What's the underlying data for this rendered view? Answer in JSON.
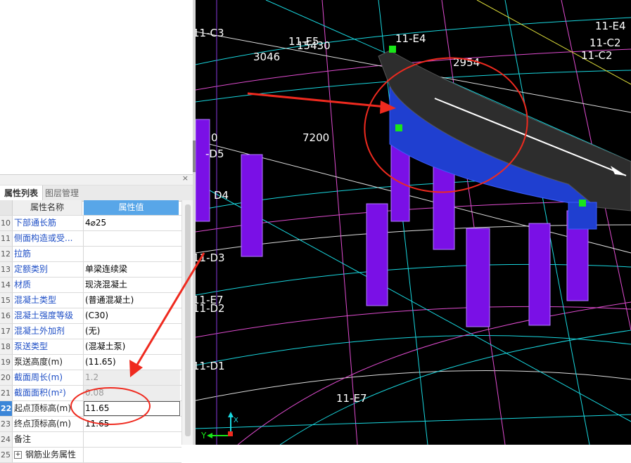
{
  "panel": {
    "close_label": "×",
    "tabs": [
      {
        "label": "属性列表",
        "active": true
      },
      {
        "label": "图层管理",
        "active": false
      }
    ],
    "header": {
      "name": "属性名称",
      "value": "属性值"
    },
    "rows": [
      {
        "num": "10",
        "name": "下部通长筋",
        "value": "4⌀25",
        "link": true
      },
      {
        "num": "11",
        "name": "侧面构造或受...",
        "value": "",
        "link": true
      },
      {
        "num": "12",
        "name": "拉筋",
        "value": "",
        "link": true
      },
      {
        "num": "13",
        "name": "定额类别",
        "value": "单梁连续梁",
        "link": true
      },
      {
        "num": "14",
        "name": "材质",
        "value": "现浇混凝土",
        "link": true
      },
      {
        "num": "15",
        "name": "混凝土类型",
        "value": "(普通混凝土)",
        "link": true
      },
      {
        "num": "16",
        "name": "混凝土强度等级",
        "value": "(C30)",
        "link": true
      },
      {
        "num": "17",
        "name": "混凝土外加剂",
        "value": "(无)",
        "link": true
      },
      {
        "num": "18",
        "name": "泵送类型",
        "value": "(混凝土泵)",
        "link": true
      },
      {
        "num": "19",
        "name": "泵送高度(m)",
        "value": "(11.65)",
        "link": false
      },
      {
        "num": "20",
        "name": "截面周长(m)",
        "value": "1.2",
        "link": true,
        "gray": true
      },
      {
        "num": "21",
        "name": "截面面积(m²)",
        "value": "0.08",
        "link": true,
        "gray": true
      },
      {
        "num": "22",
        "name": "起点顶标高(m)",
        "value": "11.65",
        "link": false,
        "selected": true,
        "boxed": true
      },
      {
        "num": "23",
        "name": "终点顶标高(m)",
        "value": "11.65",
        "link": false
      },
      {
        "num": "24",
        "name": "备注",
        "value": "",
        "link": false
      },
      {
        "num": "25",
        "name": "钢筋业务属性",
        "value": "",
        "link": false,
        "expand": "+"
      }
    ]
  },
  "viewport": {
    "grid_labels": [
      "11-C3",
      "11-E5",
      "15430",
      "11-E4",
      "11-E4",
      "11-C2",
      "11-C2",
      "3046",
      "2954",
      "7200",
      "-D5",
      "D4",
      "11-D3",
      "11-E7",
      "11-D2",
      "11-D1",
      "11-E7",
      "0"
    ],
    "axis": {
      "y_label": "Y",
      "x_label": "X"
    }
  },
  "colors": {
    "beam_top": "#2d2d2d",
    "beam_side": "#1f3fd0",
    "column": "#7a10e6",
    "annotation": "#ef2a1f",
    "selection_handle": "#19e619",
    "tab_highlight": "#58a6e8"
  }
}
